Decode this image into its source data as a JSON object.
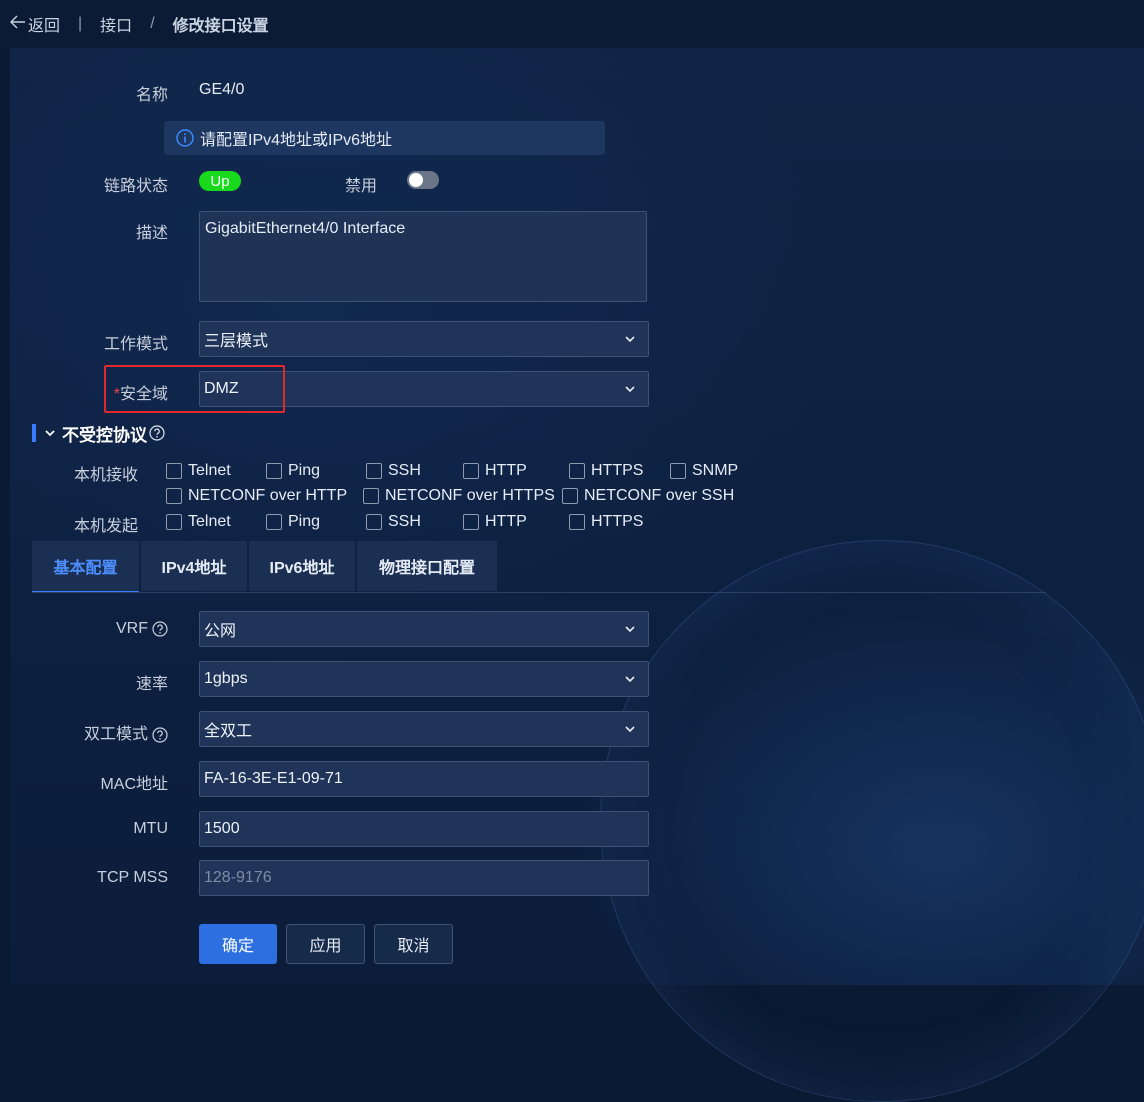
{
  "breadcrumb": {
    "back_label": "返回",
    "parent": "接口",
    "separator": "/",
    "current": "修改接口设置"
  },
  "form": {
    "name_label": "名称",
    "name_value": "GE4/0",
    "notice": "请配置IPv4地址或IPv6地址",
    "link_label": "链路状态",
    "link_status": "Up",
    "disable_label": "禁用",
    "disable_enabled": false,
    "desc_label": "描述",
    "desc_value": "GigabitEthernet4/0 Interface",
    "mode_label": "工作模式",
    "mode_value": "三层模式",
    "zone_required": "*",
    "zone_label": "安全域",
    "zone_value": "DMZ"
  },
  "protocols": {
    "title": "不受控协议",
    "receive_label": "本机接收",
    "receive_items": [
      "Telnet",
      "Ping",
      "SSH",
      "HTTP",
      "HTTPS",
      "SNMP",
      "NETCONF over HTTP",
      "NETCONF over HTTPS",
      "NETCONF over SSH"
    ],
    "send_label": "本机发起",
    "send_items": [
      "Telnet",
      "Ping",
      "SSH",
      "HTTP",
      "HTTPS"
    ]
  },
  "tabs": [
    "基本配置",
    "IPv4地址",
    "IPv6地址",
    "物理接口配置"
  ],
  "basic": {
    "vrf_label": "VRF",
    "vrf_value": "公网",
    "speed_label": "速率",
    "speed_value": "1gbps",
    "duplex_label": "双工模式",
    "duplex_value": "全双工",
    "mac_label": "MAC地址",
    "mac_value": "FA-16-3E-E1-09-71",
    "mtu_label": "MTU",
    "mtu_value": "1500",
    "mss_label": "TCP MSS",
    "mss_placeholder": "128-9176"
  },
  "buttons": {
    "confirm": "确定",
    "apply": "应用",
    "cancel": "取消"
  },
  "colors": {
    "accent": "#2d6fe0",
    "status_up": "#19d91c",
    "highlight": "#e0282e"
  }
}
